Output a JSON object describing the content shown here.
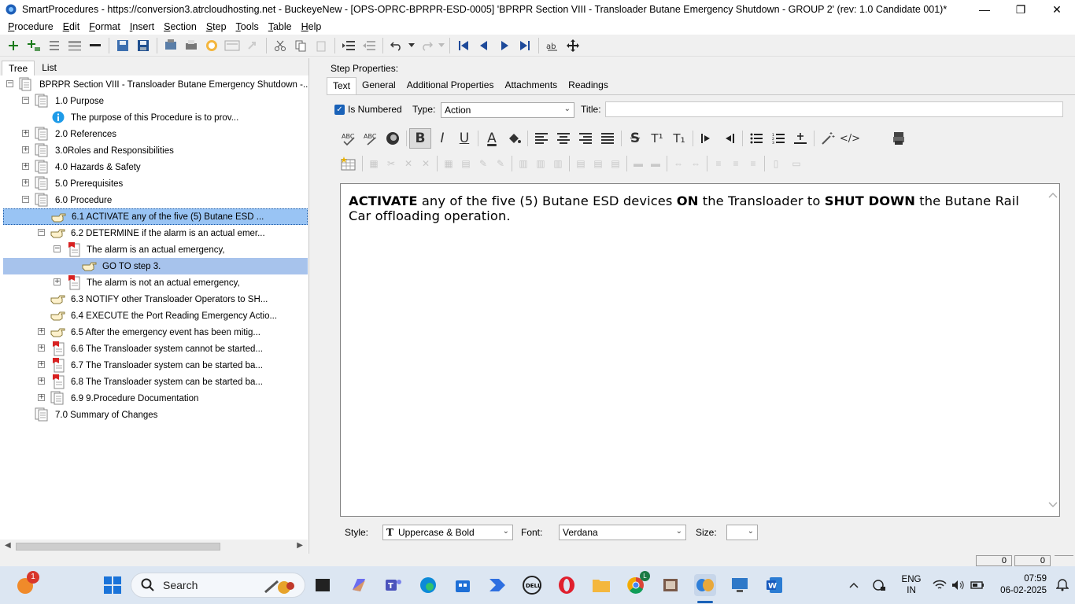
{
  "window": {
    "title": "SmartProcedures - https://conversion3.atrcloudhosting.net - BuckeyeNew - [OPS-OPRC-BPRPR-ESD-0005] 'BPRPR Section VIII - Transloader Butane Emergency Shutdown - GROUP 2' (rev: 1.0 Candidate 001)*",
    "min_glyph": "—",
    "max_glyph": "❐",
    "close_glyph": "✕"
  },
  "menu": [
    "Procedure",
    "Edit",
    "Format",
    "Insert",
    "Section",
    "Step",
    "Tools",
    "Table",
    "Help"
  ],
  "menu_mnemonics": [
    "P",
    "E",
    "F",
    "I",
    "S",
    "S",
    "T",
    "T",
    "H"
  ],
  "left_tabs": [
    "Tree",
    "List"
  ],
  "tree": [
    {
      "label": "BPRPR Section VIII - Transloader Butane Emergency Shutdown -...",
      "icon": "document-stack-icon",
      "expander": "−"
    },
    {
      "label": "1.0 Purpose",
      "icon": "section-icon",
      "expander": "−"
    },
    {
      "label": "The purpose of this Procedure is to prov...",
      "icon": "info-icon",
      "expander": ""
    },
    {
      "label": "2.0 References",
      "icon": "section-icon",
      "expander": "+"
    },
    {
      "label": "3.0Roles and Responsibilities",
      "icon": "section-icon",
      "expander": "+"
    },
    {
      "label": "4.0 Hazards & Safety",
      "icon": "section-icon",
      "expander": "+"
    },
    {
      "label": "5.0 Prerequisites",
      "icon": "section-icon",
      "expander": "+"
    },
    {
      "label": "6.0 Procedure",
      "icon": "section-icon",
      "expander": "−"
    },
    {
      "label": "6.1 ACTIVATE any of the five (5) Butane ESD ...",
      "icon": "hand-pointer-icon",
      "expander": ""
    },
    {
      "label": "6.2 DETERMINE if the alarm is an actual emer...",
      "icon": "hand-pointer-icon",
      "expander": "−"
    },
    {
      "label": "The alarm is an actual emergency,",
      "icon": "condition-flag-icon",
      "expander": "−"
    },
    {
      "label": "GO TO step 3.",
      "icon": "hand-pointer-icon",
      "expander": ""
    },
    {
      "label": "The alarm is not an actual emergency,",
      "icon": "condition-flag-icon",
      "expander": "+"
    },
    {
      "label": "6.3 NOTIFY other Transloader Operators to SH...",
      "icon": "hand-pointer-icon",
      "expander": ""
    },
    {
      "label": "6.4 EXECUTE the Port Reading Emergency Actio...",
      "icon": "hand-pointer-icon",
      "expander": ""
    },
    {
      "label": "6.5 After the emergency event has been mitig...",
      "icon": "hand-pointer-icon",
      "expander": "+"
    },
    {
      "label": "6.6 The Transloader system cannot be started...",
      "icon": "condition-flag-icon",
      "expander": "+"
    },
    {
      "label": "6.7 The Transloader system can be started ba...",
      "icon": "condition-flag-icon",
      "expander": "+"
    },
    {
      "label": "6.8 The Transloader system can be started ba...",
      "icon": "condition-flag-icon",
      "expander": "+"
    },
    {
      "label": "6.9  9.Procedure Documentation",
      "icon": "section-icon",
      "expander": "+"
    },
    {
      "label": "7.0 Summary of Changes",
      "icon": "section-icon",
      "expander": ""
    }
  ],
  "step_properties": {
    "label": "Step Properties:",
    "tabs": [
      "Text",
      "General",
      "Additional Properties",
      "Attachments",
      "Readings"
    ],
    "is_numbered_label": "Is Numbered",
    "is_numbered_check": "✓",
    "type_label": "Type:",
    "type_value": "Action",
    "title_label": "Title:",
    "title_value": ""
  },
  "editor": {
    "segments": [
      {
        "text": "ACTIVATE",
        "bold": true
      },
      {
        "text": " any of the five (5) Butane ESD devices ",
        "bold": false
      },
      {
        "text": "ON",
        "bold": true
      },
      {
        "text": " the Transloader to ",
        "bold": false
      },
      {
        "text": "SHUT DOWN",
        "bold": true
      },
      {
        "text": " the Butane Rail Car offloading operation.",
        "bold": false
      }
    ]
  },
  "format_bar": {
    "bold": "B",
    "italic": "I",
    "underline": "U",
    "font_color": "A",
    "strike": "S",
    "superscript": "T¹",
    "subscript": "T₁",
    "code": "</>"
  },
  "style_bar": {
    "style_label": "Style:",
    "style_prefix": "T",
    "style_value": "Uppercase & Bold",
    "font_label": "Font:",
    "font_value": "Verdana",
    "size_label": "Size:",
    "size_value": ""
  },
  "status": {
    "box1": "0",
    "box2": "0"
  },
  "taskbar": {
    "search_placeholder": "Search",
    "notification_badge": "1",
    "outlook_badge": "L",
    "lang": "ENG",
    "region": "IN",
    "time": "07:59",
    "date": "06-02-2025"
  },
  "colors": {
    "selection": "#99c4f4",
    "selection_secondary": "#a7c3ec",
    "checkbox": "#1a62b8",
    "taskbar": "#dce6f2"
  }
}
